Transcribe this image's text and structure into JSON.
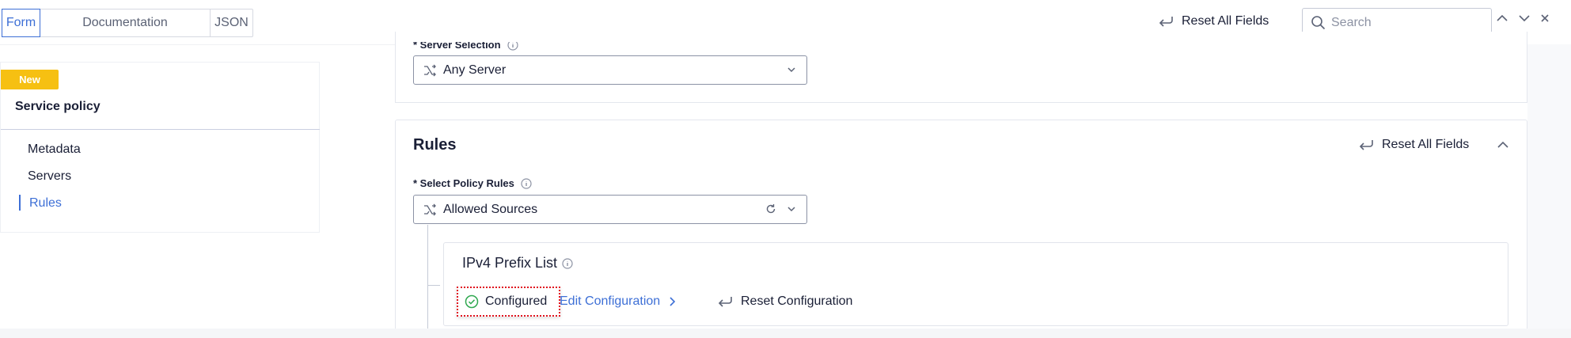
{
  "tabs": [
    {
      "label": "Form",
      "active": true
    },
    {
      "label": "Documentation",
      "active": false
    },
    {
      "label": "JSON",
      "active": false
    }
  ],
  "header": {
    "reset_all": "Reset All Fields",
    "search_placeholder": "Search"
  },
  "sidebar": {
    "badge": "New",
    "title": "Service policy",
    "items": [
      {
        "label": "Metadata",
        "active": false
      },
      {
        "label": "Servers",
        "active": false
      },
      {
        "label": "Rules",
        "active": true
      }
    ]
  },
  "server_section": {
    "label": "* Server Selection",
    "value": "Any Server"
  },
  "rules_section": {
    "title": "Rules",
    "reset_all": "Reset All Fields",
    "select_label": "* Select Policy Rules",
    "select_value": "Allowed Sources"
  },
  "prefix_card": {
    "title": "IPv4 Prefix List",
    "status": "Configured",
    "edit": "Edit Configuration",
    "reset": "Reset Configuration"
  },
  "colors": {
    "accent": "#3d6fd6",
    "badge": "#f6c012",
    "success": "#2fa84f",
    "highlight": "#e0131f"
  },
  "icons": {
    "reset": "undo-arrow-icon",
    "search": "search-icon",
    "info": "info-icon",
    "route": "route-icon",
    "chevron_down": "chevron-down-icon",
    "chevron_up": "chevron-up-icon",
    "chevron_right": "chevron-right-icon",
    "refresh": "refresh-icon",
    "check": "check-circle-icon",
    "close": "close-icon"
  }
}
